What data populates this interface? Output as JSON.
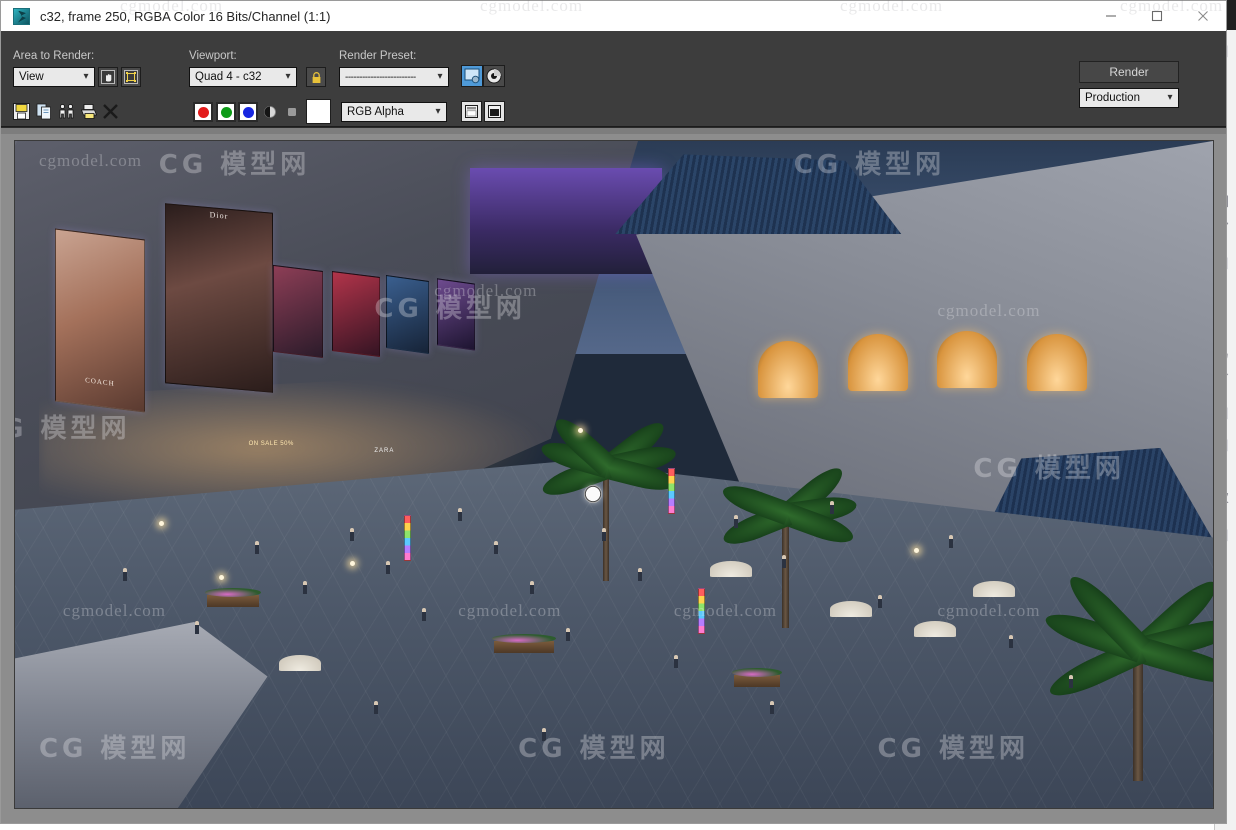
{
  "window": {
    "title": "c32, frame 250, RGBA Color 16 Bits/Channel (1:1)",
    "app_icon": "render-frame-icon",
    "controls": {
      "minimize": "—",
      "maximize": "☐",
      "close": "✕"
    }
  },
  "toolbar": {
    "area_to_render_label": "Area to Render:",
    "area_to_render_value": "View",
    "viewport_label": "Viewport:",
    "viewport_value": "Quad 4 - c32",
    "render_preset_label": "Render Preset:",
    "render_preset_value": "-------------------------",
    "render_button": "Render",
    "render_mode_value": "Production",
    "lock_icon": "lock-icon",
    "pan_region_icon": "hand-pan-icon",
    "sub_region_icon": "region-select-icon",
    "preset_load_icon": "preset-load-icon",
    "environment_icon": "environment-sphere-icon"
  },
  "imagetools": {
    "save_icon": "save-floppy-icon",
    "copy_icon": "copy-icon",
    "clone_icon": "clone-window-icon",
    "print_icon": "print-icon",
    "clear_icon": "clear-x-icon",
    "channel_red": "red-channel-toggle",
    "channel_green": "green-channel-toggle",
    "channel_blue": "blue-channel-toggle",
    "channel_alpha": "alpha-channel-toggle",
    "channel_mono": "mono-channel-toggle",
    "background_swatch": "background-color-swatch",
    "colors": {
      "red": "#e31b1b",
      "green": "#0e9b18",
      "blue": "#1726e0",
      "swatch": "#ffffff"
    },
    "channel_select_value": "RGB Alpha",
    "layout_icon_1": "toggle-ui-icon",
    "layout_icon_2": "toggle-image-icon"
  },
  "render": {
    "scene_description": "Night-time architectural rendering of an outdoor shopping plaza",
    "billboards": [
      {
        "brand": "COACH"
      },
      {
        "brand": "Dior"
      },
      {
        "brand": ""
      },
      {
        "brand": ""
      },
      {
        "brand": ""
      }
    ],
    "store_signs": [
      "ON SALE 50%",
      "ZARA"
    ],
    "watermarks_latin": "cgmodel.com",
    "watermarks_cn": "CG 模型网"
  },
  "background_window": {
    "glyphs": [
      "图",
      "多",
      "易",
      "身",
      "V",
      "次"
    ]
  },
  "colors": {
    "toolbar_bg": "#3d3d3d",
    "titlebar_bg": "#ffffff",
    "frame_bg": "#8d8d8d",
    "combo_bg": "#e9e9e9",
    "text_light": "#c8c8c8"
  }
}
